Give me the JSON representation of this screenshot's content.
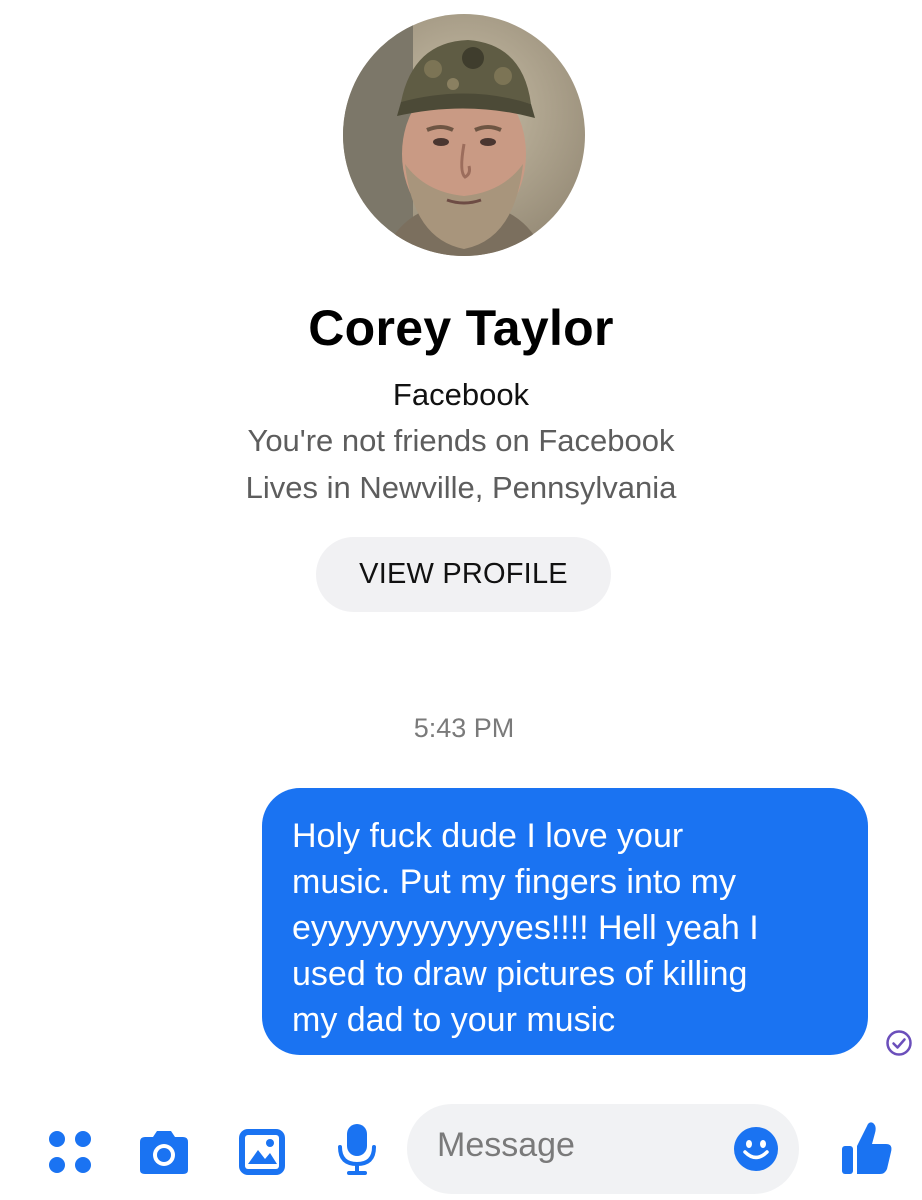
{
  "profile": {
    "name": "Corey Taylor",
    "platform": "Facebook",
    "friend_status": "You're not friends on Facebook",
    "location": "Lives in Newville, Pennsylvania",
    "view_profile_label": "VIEW PROFILE"
  },
  "conversation": {
    "timestamp": "5:43 PM",
    "messages": [
      {
        "direction": "outgoing",
        "lines": [
          "Holy fuck dude I love your",
          "music. Put my fingers into my",
          "eyyyyyyyyyyyyes!!!! Hell yeah I",
          "used to draw pictures of killing",
          "my dad to your music"
        ],
        "status_icon": "seen-check-icon"
      }
    ]
  },
  "composer": {
    "message_placeholder": "Message",
    "icons": [
      "more-icon",
      "camera-icon",
      "gallery-icon",
      "microphone-icon",
      "emoji-icon",
      "like-icon"
    ]
  },
  "colors": {
    "accent": "#1a73f2",
    "bubble_text": "#ffffff",
    "seen_check": "#6b4fbb",
    "secondary_text": "#5d5d5d"
  }
}
